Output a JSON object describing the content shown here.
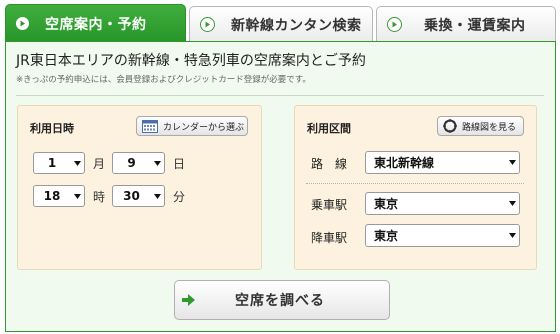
{
  "tabs": [
    {
      "label": "空席案内・予約",
      "active": true
    },
    {
      "label": "新幹線カンタン検索",
      "active": false
    },
    {
      "label": "乗換・運賃案内",
      "active": false
    }
  ],
  "header": {
    "title": "JR東日本エリアの新幹線・特急列車の空席案内とご予約",
    "note": "※きっぷの予約申込には、会員登録およびクレジットカード登録が必要です。"
  },
  "date_box": {
    "title": "利用日時",
    "calendar_button": "カレンダーから選ぶ",
    "month_value": "1",
    "month_unit": "月",
    "day_value": "9",
    "day_unit": "日",
    "hour_value": "18",
    "hour_unit": "時",
    "minute_value": "30",
    "minute_unit": "分"
  },
  "section_box": {
    "title": "利用区間",
    "map_button": "路線図を見る",
    "line_label": "路　線",
    "line_value": "東北新幹線",
    "from_label": "乗車駅",
    "from_value": "東京",
    "to_label": "降車駅",
    "to_value": "東京"
  },
  "search_button": "空席を調べる",
  "colors": {
    "brand_green": "#2f9a2f",
    "panel_bg": "#f1faee",
    "box_bg": "#fdf2df"
  }
}
